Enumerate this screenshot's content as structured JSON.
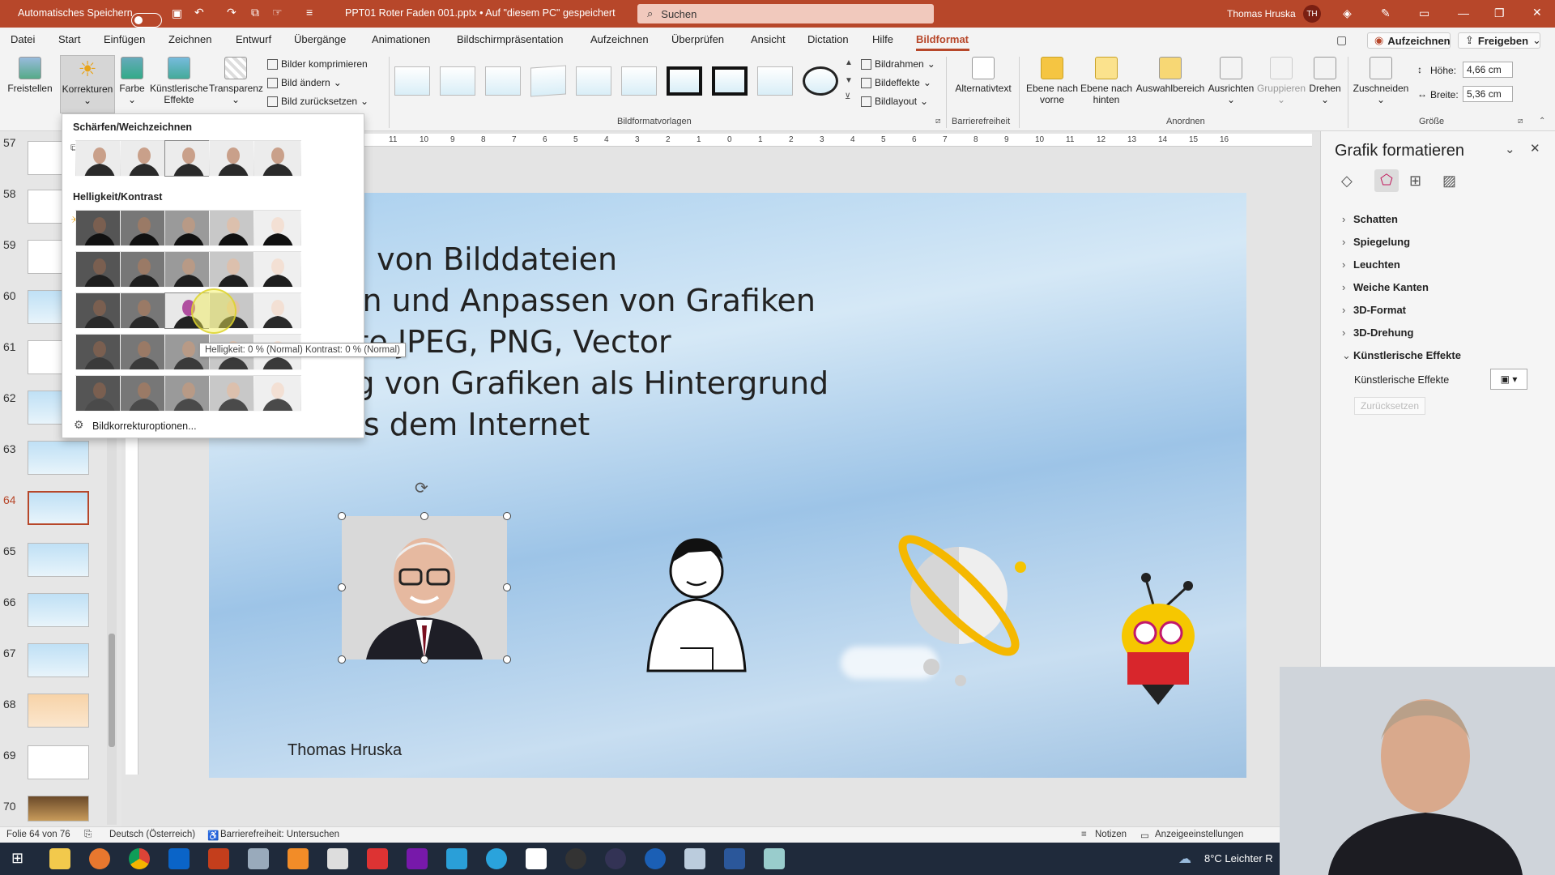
{
  "titlebar": {
    "autosave_label": "Automatisches Speichern",
    "doc_title": "PPT01 Roter Faden 001.pptx • Auf \"diesem PC\" gespeichert",
    "search_placeholder": "Suchen",
    "user_name": "Thomas Hruska",
    "user_initials": "TH"
  },
  "menu": {
    "items": [
      "Datei",
      "Start",
      "Einfügen",
      "Zeichnen",
      "Entwurf",
      "Übergänge",
      "Animationen",
      "Bildschirmpräsentation",
      "Aufzeichnen",
      "Überprüfen",
      "Ansicht",
      "Dictation",
      "Hilfe",
      "Bildformat"
    ],
    "active": "Bildformat",
    "record_button": "Aufzeichnen",
    "share_button": "Freigeben"
  },
  "ribbon": {
    "freistellen": "Freistellen",
    "korrekturen": "Korrekturen",
    "farbe": "Farbe",
    "kuenstlerische": "Künstlerische Effekte",
    "transparenz": "Transparenz",
    "bilder_komprimieren": "Bilder komprimieren",
    "bild_aendern": "Bild ändern",
    "bild_zuruecksetzen": "Bild zurücksetzen",
    "bildrahmen": "Bildrahmen",
    "bildeffekte": "Bildeffekte",
    "bildlayout": "Bildlayout",
    "group_bildformatvorlagen": "Bildformatvorlagen",
    "alternativtext": "Alternativtext",
    "group_barrierefreiheit": "Barrierefreiheit",
    "ebene_vorne": "Ebene nach vorne",
    "ebene_hinten": "Ebene nach hinten",
    "auswahlbereich": "Auswahlbereich",
    "ausrichten": "Ausrichten",
    "gruppieren": "Gruppieren",
    "drehen": "Drehen",
    "group_anordnen": "Anordnen",
    "zuschneiden": "Zuschneiden",
    "hoehe_label": "Höhe:",
    "hoehe_value": "4,66 cm",
    "breite_label": "Breite:",
    "breite_value": "5,36 cm",
    "group_groesse": "Größe"
  },
  "slides": {
    "numbers": [
      "57",
      "58",
      "59",
      "60",
      "61",
      "62",
      "63",
      "64",
      "65",
      "66",
      "67",
      "68",
      "69",
      "70"
    ],
    "selected": "64"
  },
  "ruler": {
    "top_labels": [
      "11",
      "10",
      "9",
      "8",
      "7",
      "6",
      "5",
      "4",
      "3",
      "2",
      "1",
      "0",
      "1",
      "2",
      "3",
      "4",
      "5",
      "6",
      "7",
      "8",
      "9",
      "10",
      "11",
      "12",
      "13",
      "14",
      "15",
      "16"
    ]
  },
  "slide": {
    "bullets": [
      "tieren von Bilddateien",
      "neiden und Anpassen von Grafiken",
      "ormate JPEG, PNG, Vector",
      "ndung von Grafiken als Hintergrund",
      "en aus dem Internet"
    ],
    "author": "Thomas Hruska"
  },
  "corrections": {
    "sharpen_title": "Schärfen/Weichzeichnen",
    "brightness_title": "Helligkeit/Kontrast",
    "options_link": "Bildkorrekturoptionen...",
    "tooltip": "Helligkeit: 0 % (Normal) Kontrast: 0 % (Normal)"
  },
  "format_pane": {
    "title": "Grafik formatieren",
    "sections": [
      "Schatten",
      "Spiegelung",
      "Leuchten",
      "Weiche Kanten",
      "3D-Format",
      "3D-Drehung",
      "Künstlerische Effekte"
    ],
    "expanded_label": "Künstlerische Effekte",
    "reset_button": "Zurücksetzen"
  },
  "status": {
    "slide_info": "Folie 64 von 76",
    "language": "Deutsch (Österreich)",
    "accessibility": "Barrierefreiheit: Untersuchen",
    "notes": "Notizen",
    "display_settings": "Anzeigeeinstellungen"
  },
  "taskbar": {
    "weather": "8°C  Leichter R"
  },
  "colors": {
    "accent": "#b7472a"
  }
}
